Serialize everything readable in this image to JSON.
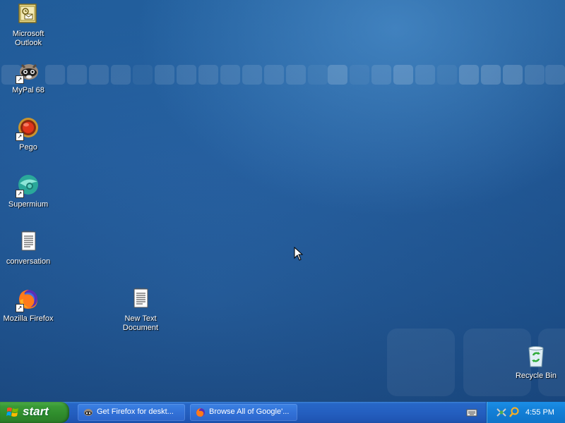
{
  "desktop": {
    "icons": [
      {
        "label": "Microsoft\nOutlook",
        "icon": "outlook-icon"
      },
      {
        "label": "MyPal 68",
        "icon": "mypal-icon"
      },
      {
        "label": "Pego",
        "icon": "pego-icon"
      },
      {
        "label": "Supermium",
        "icon": "supermium-icon"
      },
      {
        "label": "conversation",
        "icon": "text-document-icon"
      },
      {
        "label": "Mozilla Firefox",
        "icon": "firefox-icon"
      },
      {
        "label": "New Text\nDocument",
        "icon": "text-document-icon"
      },
      {
        "label": "Recycle Bin",
        "icon": "recycle-bin-icon"
      }
    ]
  },
  "taskbar": {
    "start_label": "start",
    "tasks": [
      {
        "label": "Get Firefox for deskt...",
        "icon": "mypal-icon"
      },
      {
        "label": "Browse All of Google'...",
        "icon": "firefox-icon"
      }
    ],
    "tray": {
      "clock": "4:55 PM",
      "icons": [
        "keyboard-icon",
        "network-icon",
        "search-icon"
      ]
    }
  },
  "colors": {
    "desktop_blue": "#2a66a8",
    "taskbar_blue": "#245fc0",
    "start_green": "#3a9a36",
    "tray_blue": "#1380d8"
  }
}
